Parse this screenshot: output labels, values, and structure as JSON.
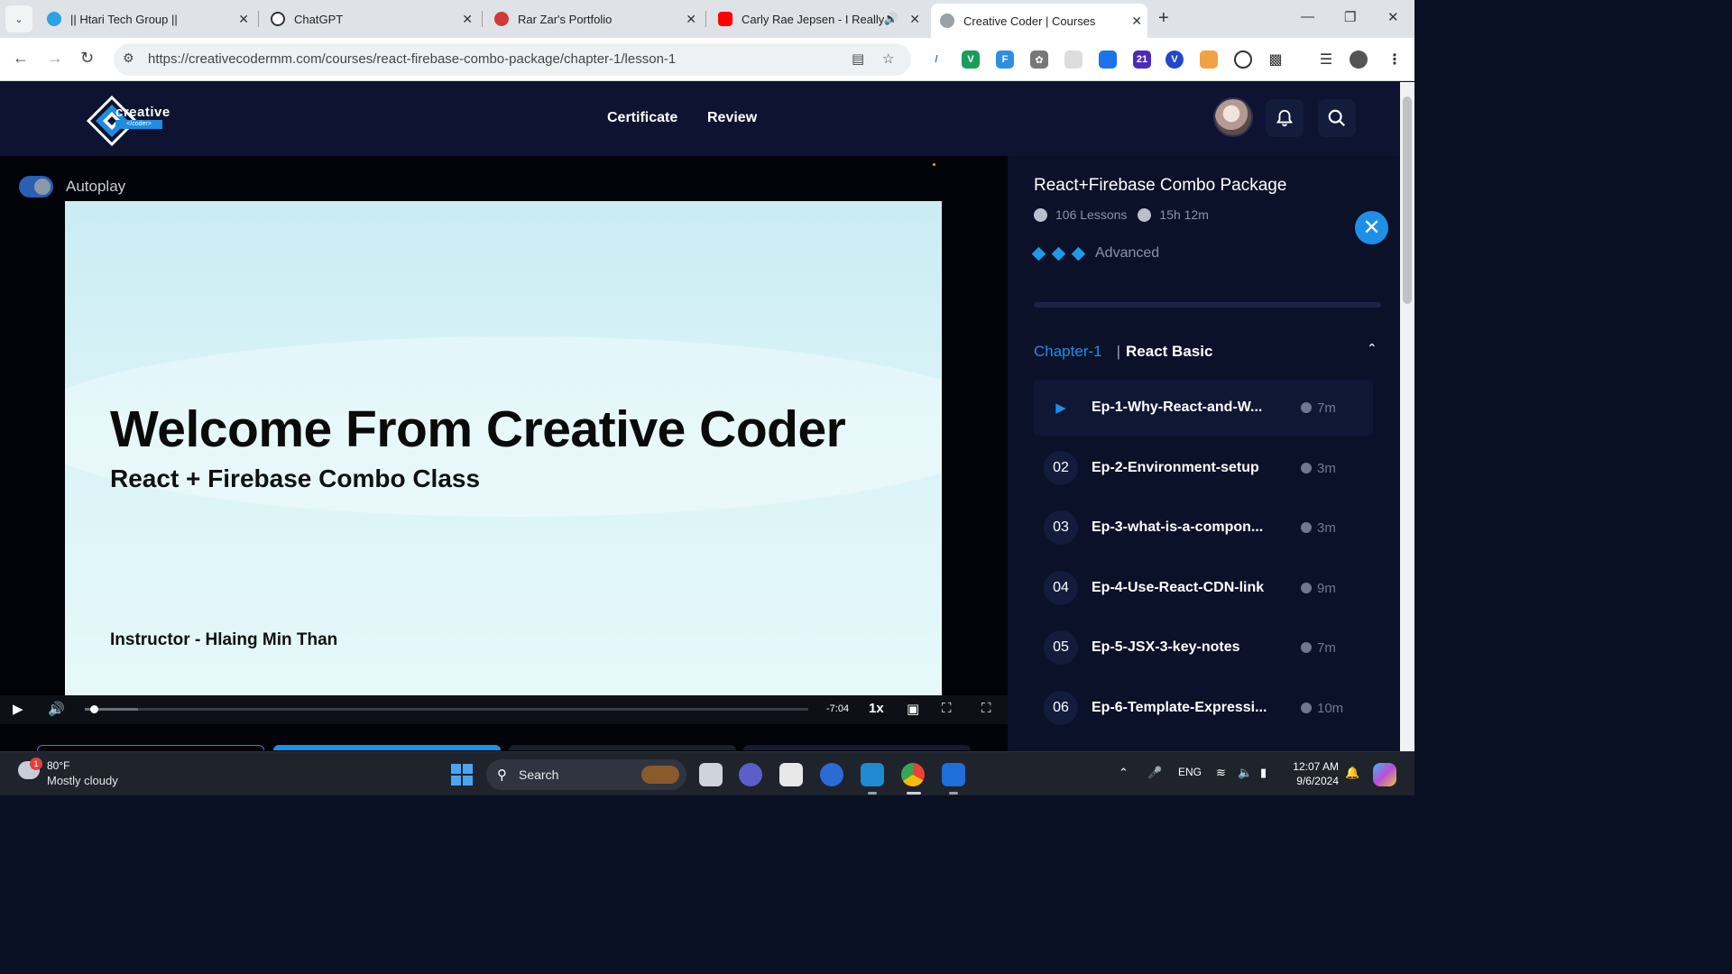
{
  "browser": {
    "tabs": [
      {
        "title": "|| Htari Tech Group ||",
        "color": "#2aa3e0"
      },
      {
        "title": "ChatGPT",
        "color": "#333333"
      },
      {
        "title": "Rar Zar's Portfolio",
        "color": "#d23a3a"
      },
      {
        "title": "Carly Rae Jepsen - I Really",
        "color": "#ff0000"
      },
      {
        "title": "Creative Coder | Courses",
        "color": "#7a7a7a"
      }
    ],
    "url": "https://creativecodermm.com/courses/react-firebase-combo-package/chapter-1/lesson-1",
    "extension_badge": "21"
  },
  "header": {
    "logo_word": "creative",
    "logo_tag": "</coder>",
    "nav": [
      "Certificate",
      "Review"
    ]
  },
  "player": {
    "autoplay_label": "Autoplay",
    "autoplay_on": true,
    "slide": {
      "title": "Welcome From Creative Coder",
      "subtitle": "React + Firebase Combo Class",
      "instructor": "Instructor - Hlaing Min Than"
    },
    "time_remaining": "-7:04",
    "speed": "1x",
    "progress_fraction": 0.013,
    "buffered_fraction": 0.074
  },
  "course": {
    "title": "React+Firebase Combo Package",
    "lessons_count": "106 Lessons",
    "duration": "15h 12m",
    "level": "Advanced",
    "chapter_num": "Chapter-1",
    "chapter_name": "React Basic",
    "lessons": [
      {
        "num": "",
        "title": "Ep-1-Why-React-and-W...",
        "dur": "7m",
        "active": true
      },
      {
        "num": "02",
        "title": "Ep-2-Environment-setup",
        "dur": "3m"
      },
      {
        "num": "03",
        "title": "Ep-3-what-is-a-compon...",
        "dur": "3m"
      },
      {
        "num": "04",
        "title": "Ep-4-Use-React-CDN-link",
        "dur": "9m"
      },
      {
        "num": "05",
        "title": "Ep-5-JSX-3-key-notes",
        "dur": "7m"
      },
      {
        "num": "06",
        "title": "Ep-6-Template-Expressi...",
        "dur": "10m"
      }
    ]
  },
  "taskbar": {
    "weather_badge": "1",
    "temp": "80°F",
    "weather": "Mostly cloudy",
    "search_label": "Search",
    "lang": "ENG",
    "time": "12:07 AM",
    "date": "9/6/2024"
  },
  "colors": {
    "accent": "#1e8fe6",
    "header_bg": "#0d1330",
    "sidebar_bg": "#0b1128"
  }
}
